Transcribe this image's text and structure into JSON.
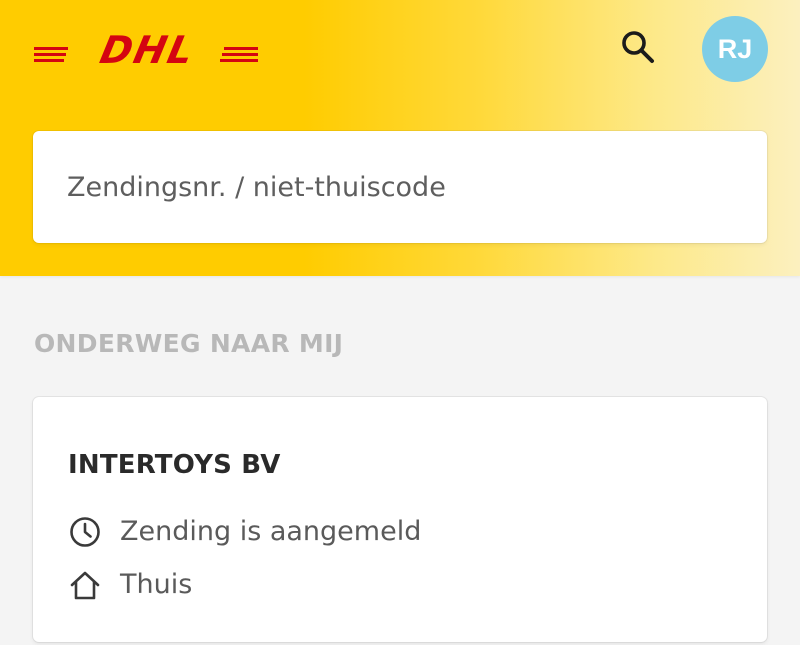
{
  "header": {
    "logo_text": "DHL",
    "brand_colors": {
      "yellow": "#FFCC00",
      "red": "#D40511"
    },
    "search_icon": "search-icon",
    "avatar_initials": "RJ",
    "avatar_color": "#7ECDE6"
  },
  "search": {
    "placeholder": "Zendingsnr. / niet-thuiscode"
  },
  "section": {
    "title": "ONDERWEG NAAR MIJ"
  },
  "shipments": [
    {
      "sender": "INTERTOYS BV",
      "status": "Zending is aangemeld",
      "status_icon": "clock-icon",
      "destination": "Thuis",
      "destination_icon": "home-icon"
    }
  ]
}
